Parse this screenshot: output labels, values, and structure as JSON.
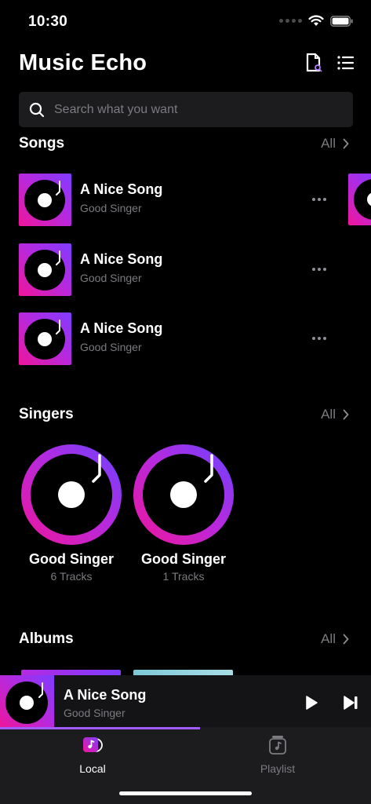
{
  "status_bar": {
    "time": "10:30"
  },
  "header": {
    "title": "Music Echo",
    "icons": [
      "document-search-icon",
      "list-menu-icon"
    ]
  },
  "search": {
    "placeholder": "Search what you want"
  },
  "songs_section": {
    "title": "Songs",
    "all_label": "All",
    "items": [
      {
        "title": "A Nice Song",
        "artist": "Good Singer"
      },
      {
        "title": "A Nice Song",
        "artist": "Good Singer"
      },
      {
        "title": "A Nice Song",
        "artist": "Good Singer"
      }
    ]
  },
  "singers_section": {
    "title": "Singers",
    "all_label": "All",
    "items": [
      {
        "name": "Good Singer",
        "tracks": "6 Tracks"
      },
      {
        "name": "Good Singer",
        "tracks": "1 Tracks"
      }
    ]
  },
  "albums_section": {
    "title": "Albums",
    "all_label": "All"
  },
  "mini_player": {
    "title": "A Nice Song",
    "artist": "Good Singer",
    "progress": 0.54
  },
  "tabs": [
    {
      "label": "Local",
      "active": true,
      "icon": "music-note-disc-icon"
    },
    {
      "label": "Playlist",
      "active": false,
      "icon": "playlist-note-icon"
    }
  ],
  "colors": {
    "accent_pink": "#f0159b",
    "accent_purple": "#7f3cff",
    "inactive": "#7b7b80"
  }
}
